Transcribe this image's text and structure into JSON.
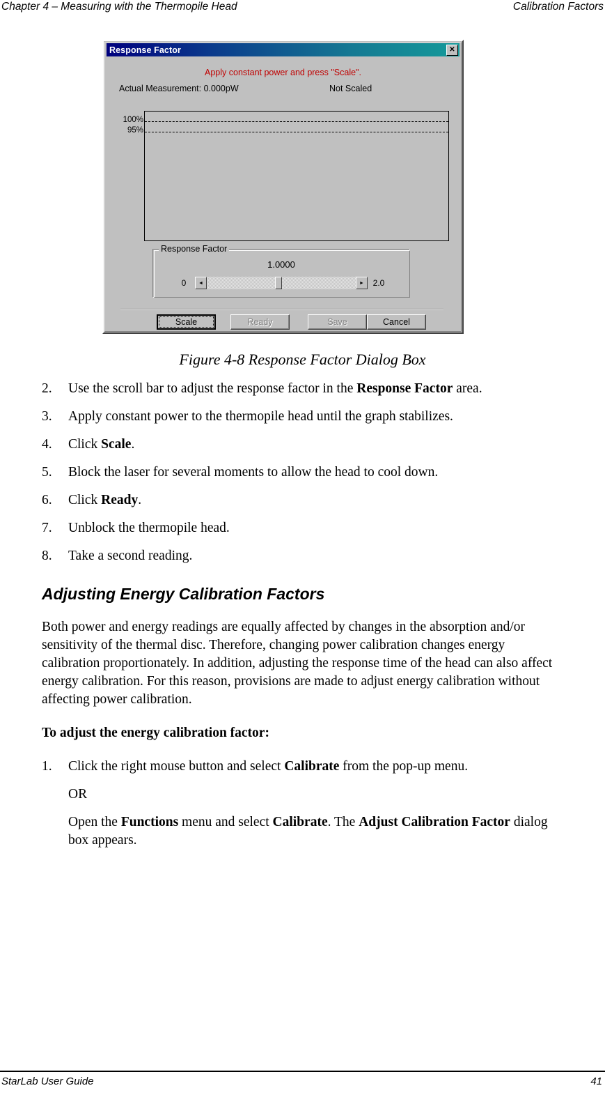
{
  "header": {
    "left": "Chapter 4 – Measuring with the Thermopile Head",
    "right": "Calibration Factors"
  },
  "dialog": {
    "title": "Response Factor",
    "close_icon": "close-icon",
    "close_glyph": "✕",
    "instruction": "Apply constant power and press \"Scale\".",
    "actual_measurement": "Actual Measurement: 0.000pW",
    "scaled_status": "Not Scaled",
    "graph": {
      "label_100": "100%",
      "label_95": "95%"
    },
    "group": {
      "legend": "Response Factor",
      "value": "1.0000",
      "min_label": "0",
      "max_label": "2.0",
      "left_arrow_glyph": "◄",
      "right_arrow_glyph": "►"
    },
    "buttons": {
      "scale": "Scale",
      "ready": "Ready",
      "save": "Save",
      "cancel": "Cancel"
    }
  },
  "figure": {
    "caption": "Figure 4-8 Response Factor Dialog Box"
  },
  "steps_first": [
    {
      "num": "2.",
      "html": "Use the scroll bar to adjust the response factor in the <b>Response Factor</b> area."
    },
    {
      "num": "3.",
      "html": "Apply constant power to the thermopile head until the graph stabilizes."
    },
    {
      "num": "4.",
      "html": "Click <b>Scale</b>."
    },
    {
      "num": "5.",
      "html": "Block the laser for several moments to allow the head to cool down."
    },
    {
      "num": "6.",
      "html": "Click <b>Ready</b>."
    },
    {
      "num": "7.",
      "html": "Unblock the thermopile head."
    },
    {
      "num": "8.",
      "html": "Take a second reading."
    }
  ],
  "section": {
    "heading": "Adjusting Energy Calibration Factors",
    "paragraph": "Both power and energy readings are equally affected by changes in the absorption and/or sensitivity of the thermal disc. Therefore, changing power calibration changes energy calibration proportionately. In addition, adjusting the response time of the head can also affect energy calibration. For this reason, provisions are made to adjust energy calibration without affecting power calibration.",
    "lead_in": "To adjust the energy calibration factor:"
  },
  "steps_second": [
    {
      "num": "1.",
      "html": "Click the right mouse button and select <b>Calibrate</b> from the pop-up menu."
    }
  ],
  "or_text": "OR",
  "alt_instruction_html": "Open the <b>Functions</b> menu and select <b>Calibrate</b>. The <b>Adjust Calibration Factor</b> dialog box appears.",
  "footer": {
    "left": "StarLab User Guide",
    "page": "41"
  }
}
